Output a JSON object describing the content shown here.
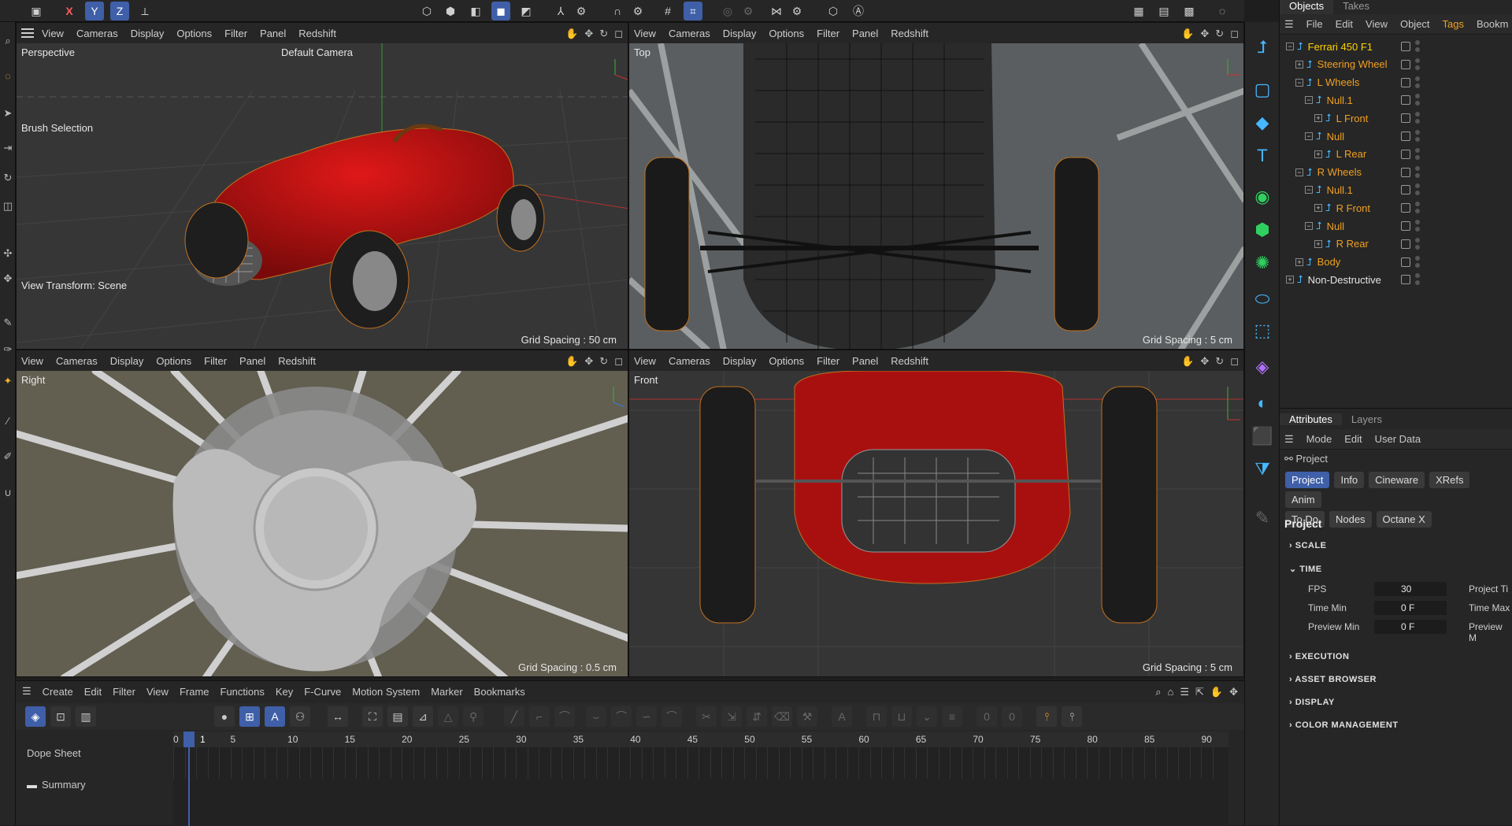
{
  "topbar": {
    "axis_x": "X",
    "axis_y": "Y",
    "axis_z": "Z",
    "tools_left": [
      "move-icon"
    ],
    "mode_icons": [
      "points-mode-icon",
      "edges-mode-icon",
      "polygons-mode-icon",
      "object-mode-icon",
      "model-mode-icon"
    ],
    "right_icons": [
      "render-view-icon",
      "render-settings-icon",
      "picture-viewer-icon",
      "startup-icon"
    ]
  },
  "viewports": {
    "menu": [
      "View",
      "Cameras",
      "Display",
      "Options",
      "Filter",
      "Panel",
      "Redshift"
    ],
    "perspective": {
      "name": "Perspective",
      "camera": "Default Camera",
      "brush": "Brush Selection",
      "transform": "View Transform: Scene",
      "grid": "Grid Spacing : 50 cm"
    },
    "top": {
      "name": "Top",
      "grid": "Grid Spacing : 5 cm"
    },
    "right": {
      "name": "Right",
      "grid": "Grid Spacing : 0.5 cm"
    },
    "front": {
      "name": "Front",
      "grid": "Grid Spacing : 5 cm"
    }
  },
  "objects": {
    "tabs": [
      "Objects",
      "Takes"
    ],
    "menu": [
      "File",
      "Edit",
      "View",
      "Object",
      "Tags",
      "Bookm"
    ],
    "tree": [
      {
        "name": "Ferrari 450 F1",
        "depth": 0,
        "exp": "−",
        "style": "sel"
      },
      {
        "name": "Steering Wheel",
        "depth": 1,
        "exp": "+",
        "style": "orange"
      },
      {
        "name": "L Wheels",
        "depth": 1,
        "exp": "−",
        "style": "orange"
      },
      {
        "name": "Null.1",
        "depth": 2,
        "exp": "−",
        "style": "orange"
      },
      {
        "name": "L Front",
        "depth": 3,
        "exp": "+",
        "style": "orange"
      },
      {
        "name": "Null",
        "depth": 2,
        "exp": "−",
        "style": "orange"
      },
      {
        "name": "L Rear",
        "depth": 3,
        "exp": "+",
        "style": "orange"
      },
      {
        "name": "R Wheels",
        "depth": 1,
        "exp": "−",
        "style": "orange"
      },
      {
        "name": "Null.1",
        "depth": 2,
        "exp": "−",
        "style": "orange"
      },
      {
        "name": "R Front",
        "depth": 3,
        "exp": "+",
        "style": "orange"
      },
      {
        "name": "Null",
        "depth": 2,
        "exp": "−",
        "style": "orange"
      },
      {
        "name": "R Rear",
        "depth": 3,
        "exp": "+",
        "style": "orange"
      },
      {
        "name": "Body",
        "depth": 1,
        "exp": "+",
        "style": "orange"
      },
      {
        "name": "Non-Destructive",
        "depth": 0,
        "exp": "+",
        "style": "white"
      }
    ]
  },
  "attributes": {
    "tabs": [
      "Attributes",
      "Layers"
    ],
    "menu": [
      "Mode",
      "Edit",
      "User Data"
    ],
    "context": "Project",
    "sub_tabs_row1": [
      "Project",
      "Info",
      "Cineware",
      "XRefs",
      "Anim"
    ],
    "sub_tabs_row2": [
      "To Do",
      "Nodes",
      "Octane X"
    ],
    "heading": "Project",
    "sections": [
      "SCALE",
      "TIME",
      "EXECUTION",
      "ASSET BROWSER",
      "DISPLAY",
      "COLOR MANAGEMENT"
    ],
    "fields": [
      {
        "label": "FPS",
        "value": "30",
        "right": "Project Ti"
      },
      {
        "label": "Time Min",
        "value": "0 F",
        "right": "Time Max"
      },
      {
        "label": "Preview Min",
        "value": "0 F",
        "right": "Preview M"
      }
    ]
  },
  "timeline": {
    "menu": [
      "Create",
      "Edit",
      "Filter",
      "View",
      "Frame",
      "Functions",
      "Key",
      "F-Curve",
      "Motion System",
      "Marker",
      "Bookmarks"
    ],
    "dope_sheet": "Dope Sheet",
    "summary": "Summary",
    "current_frame": "1",
    "ticks": [
      "0",
      "5",
      "10",
      "15",
      "20",
      "25",
      "30",
      "35",
      "40",
      "45",
      "50",
      "55",
      "60",
      "65",
      "70",
      "75",
      "80",
      "85",
      "90"
    ]
  }
}
